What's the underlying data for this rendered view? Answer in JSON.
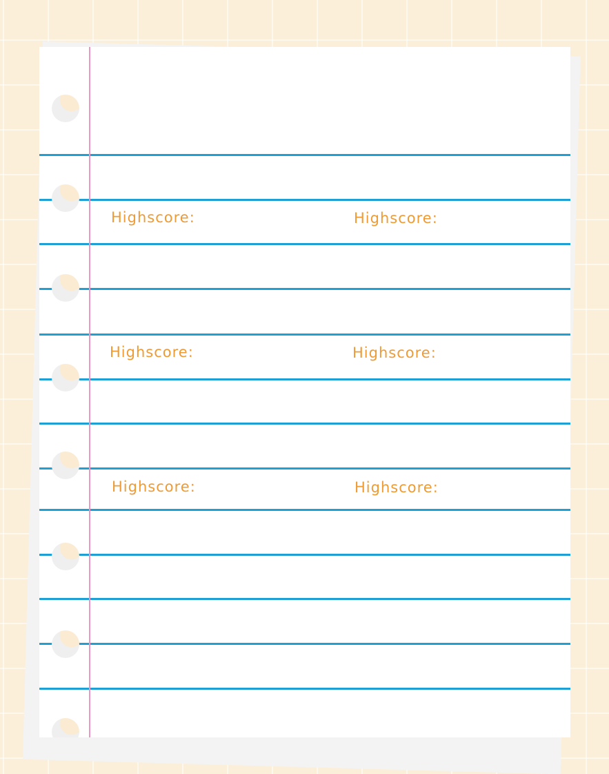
{
  "highscores": {
    "row1_left": "Highscore:",
    "row1_right": "Highscore:",
    "row2_left": "Highscore:",
    "row2_right": "Highscore:",
    "row3_left": "Highscore:",
    "row3_right": "Highscore:"
  },
  "colors": {
    "background": "#fbefda",
    "paper": "#ffffff",
    "rule_line": "#1ea0d4",
    "margin_line": "#ea97c7",
    "highscore_text": "#ef9b35"
  }
}
